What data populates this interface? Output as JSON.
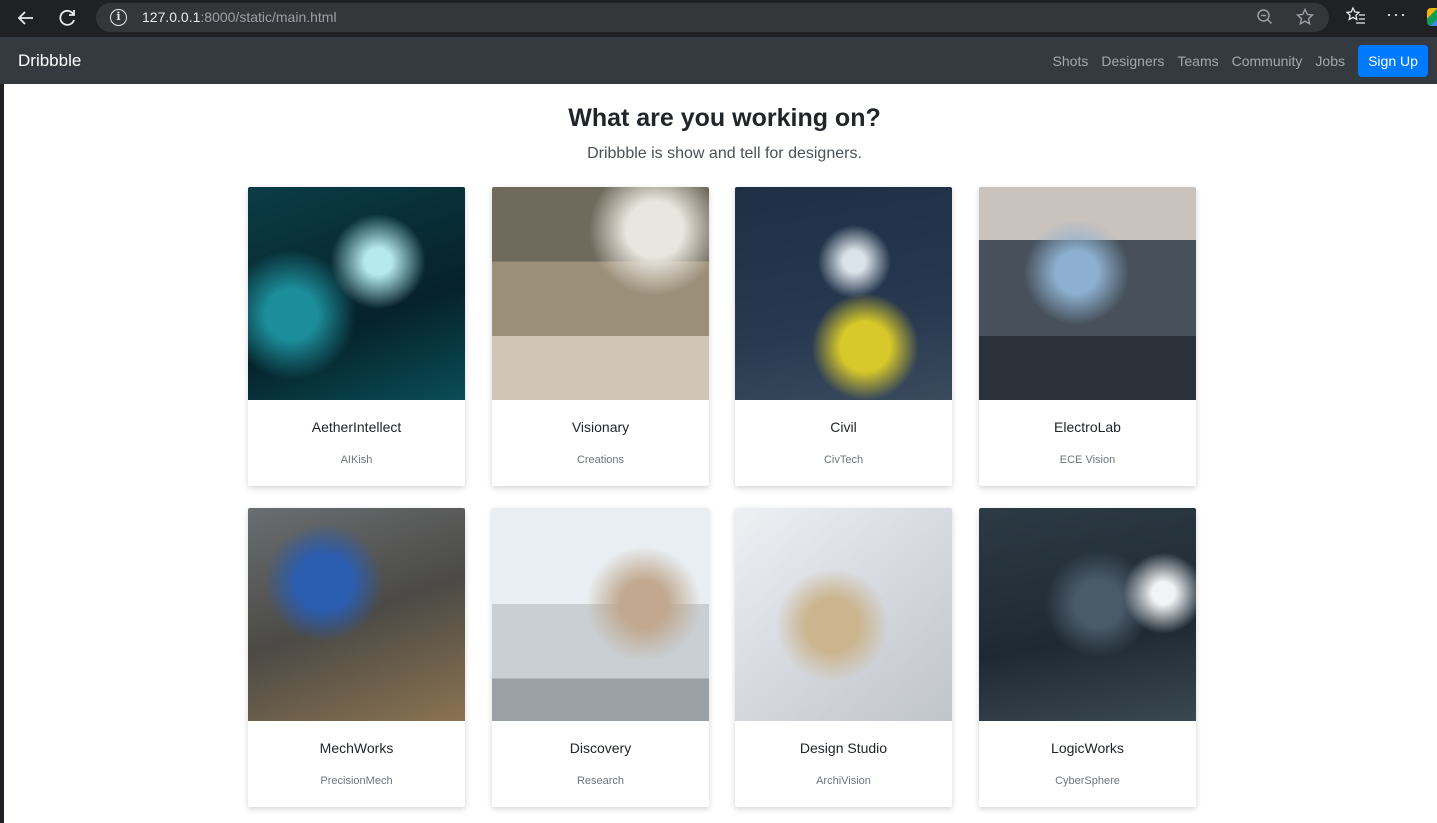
{
  "browser": {
    "url_host": "127.0.0.1",
    "url_rest": ":8000/static/main.html",
    "more_label": "···"
  },
  "navbar": {
    "brand": "Dribbble",
    "links": [
      "Shots",
      "Designers",
      "Teams",
      "Community",
      "Jobs"
    ],
    "signup_label": "Sign Up"
  },
  "hero": {
    "title": "What are you working on?",
    "subtitle": "Dribbble is show and tell for designers."
  },
  "cards": [
    {
      "title": "AetherIntellect",
      "subtitle": "AIKish",
      "image": "ai-robot-image"
    },
    {
      "title": "Visionary",
      "subtitle": "Creations",
      "image": "art-studio-image"
    },
    {
      "title": "Civil",
      "subtitle": "CivTech",
      "image": "civil-engineers-image"
    },
    {
      "title": "ElectroLab",
      "subtitle": "ECE Vision",
      "image": "electronics-lab-image"
    },
    {
      "title": "MechWorks",
      "subtitle": "PrecisionMech",
      "image": "mechanic-workshop-image"
    },
    {
      "title": "Discovery",
      "subtitle": "Research",
      "image": "research-lab-image"
    },
    {
      "title": "Design Studio",
      "subtitle": "ArchiVision",
      "image": "architecture-model-image"
    },
    {
      "title": "LogicWorks",
      "subtitle": "CyberSphere",
      "image": "computer-team-image"
    }
  ],
  "colors": {
    "navbar_bg": "#343a40",
    "primary": "#007bff"
  }
}
